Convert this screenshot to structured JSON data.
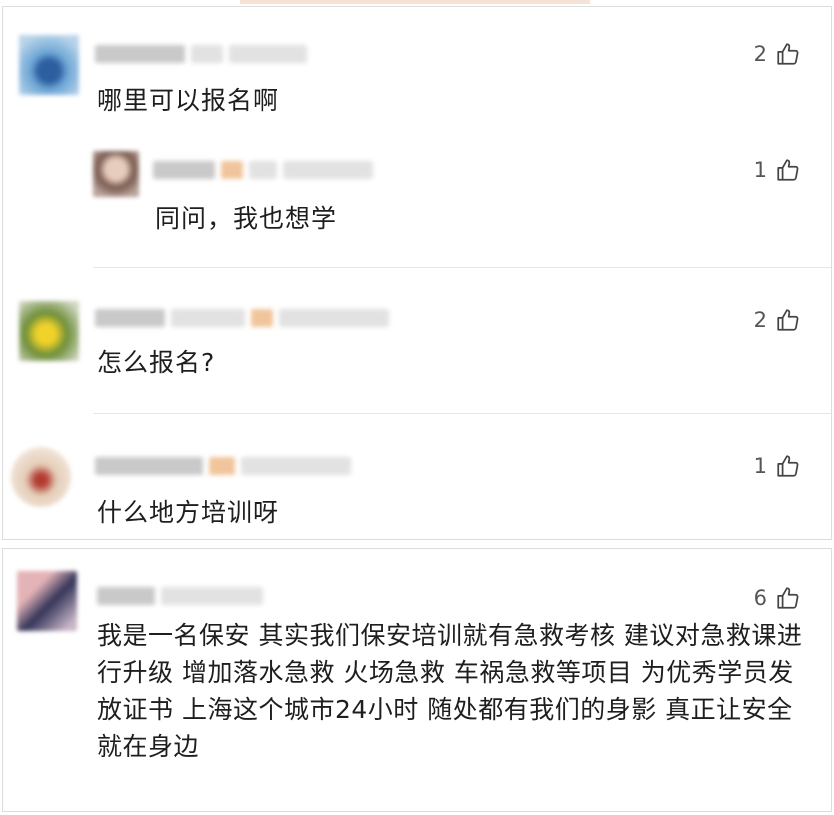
{
  "comments_top": [
    {
      "likes": "2",
      "text": "哪里可以报名啊",
      "avatar_color": "#6fa7d6"
    },
    {
      "likes": "1",
      "text": "同问，我也想学",
      "avatar_color": "#a07e74"
    },
    {
      "likes": "2",
      "text": "怎么报名?",
      "avatar_color": "#c7c24a"
    },
    {
      "likes": "1",
      "text": "什么地方培训呀",
      "avatar_color": "#d8bfa8"
    }
  ],
  "comment_bottom": {
    "likes": "6",
    "text": "我是一名保安 其实我们保安培训就有急救考核 建议对急救课进行升级 增加落水急救 火场急救 车祸急救等项目 为优秀学员发放证书 上海这个城市24小时 随处都有我们的身影 真正让安全就在身边",
    "avatar_color": "#7f6a8f"
  },
  "icons": {
    "like": "thumbs-up-icon"
  }
}
